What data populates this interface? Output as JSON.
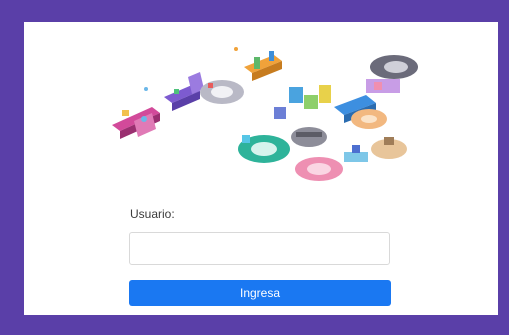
{
  "login": {
    "username_label": "Usuario:",
    "username_value": "",
    "username_placeholder": "",
    "submit_label": "Ingresa"
  },
  "theme": {
    "frame_color": "#5a3fa8",
    "card_color": "#ffffff",
    "button_color": "#1a78f2"
  },
  "logo": {
    "icon": "isometric-city-letters-logo"
  }
}
